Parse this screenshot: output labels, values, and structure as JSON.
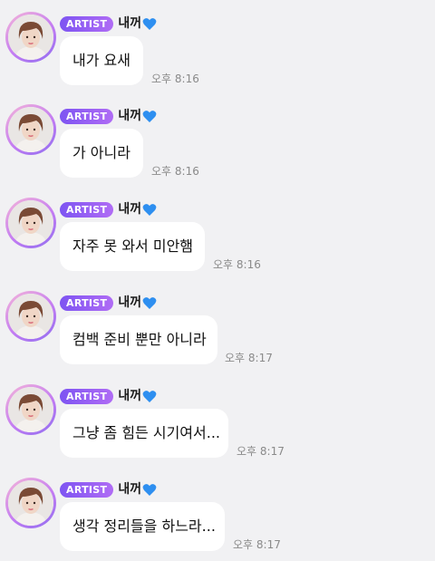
{
  "colors": {
    "background": "#f1f1f3",
    "bubble": "#ffffff",
    "badge_start": "#7d54f2",
    "badge_end": "#b06cf5",
    "heart": "#2e8ff0",
    "timestamp": "#8a8a8a"
  },
  "messages": [
    {
      "badge": "ARTIST",
      "sender": "내꺼",
      "heart_icon": "blue-heart-icon",
      "text": "내가 요새",
      "time": "오후 8:16"
    },
    {
      "badge": "ARTIST",
      "sender": "내꺼",
      "heart_icon": "blue-heart-icon",
      "text": "가 아니라",
      "time": "오후 8:16"
    },
    {
      "badge": "ARTIST",
      "sender": "내꺼",
      "heart_icon": "blue-heart-icon",
      "text": "자주 못 와서 미안햄",
      "time": "오후 8:16"
    },
    {
      "badge": "ARTIST",
      "sender": "내꺼",
      "heart_icon": "blue-heart-icon",
      "text": "컴백 준비 뿐만 아니라",
      "time": "오후 8:17"
    },
    {
      "badge": "ARTIST",
      "sender": "내꺼",
      "heart_icon": "blue-heart-icon",
      "text": "그냥 좀 힘든 시기여서...",
      "time": "오후 8:17"
    },
    {
      "badge": "ARTIST",
      "sender": "내꺼",
      "heart_icon": "blue-heart-icon",
      "text": "생각 정리들을 하느라...",
      "time": "오후 8:17"
    }
  ]
}
